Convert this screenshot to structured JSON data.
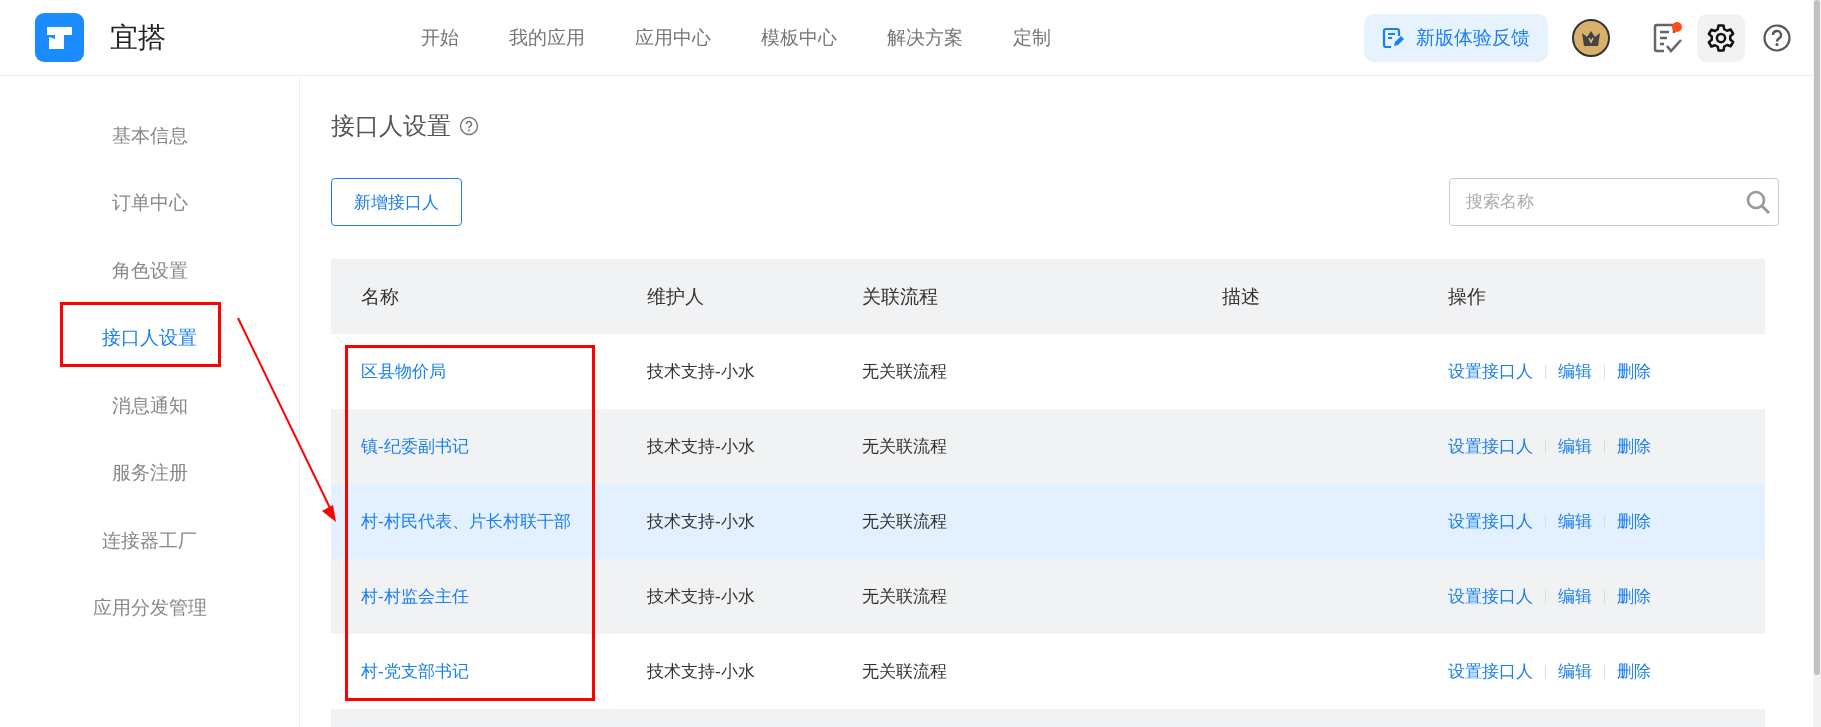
{
  "header": {
    "brand": "宜搭",
    "nav": [
      {
        "label": "开始"
      },
      {
        "label": "我的应用"
      },
      {
        "label": "应用中心"
      },
      {
        "label": "模板中心"
      },
      {
        "label": "解决方案"
      },
      {
        "label": "定制"
      }
    ],
    "feedback_button": "新版体验反馈"
  },
  "sidebar": {
    "items": [
      {
        "label": "基本信息",
        "selected": false
      },
      {
        "label": "订单中心",
        "selected": false
      },
      {
        "label": "角色设置",
        "selected": false
      },
      {
        "label": "接口人设置",
        "selected": true
      },
      {
        "label": "消息通知",
        "selected": false
      },
      {
        "label": "服务注册",
        "selected": false
      },
      {
        "label": "连接器工厂",
        "selected": false
      },
      {
        "label": "应用分发管理",
        "selected": false
      }
    ]
  },
  "page": {
    "title": "接口人设置",
    "add_button": "新增接口人",
    "search": {
      "placeholder": "搜索名称"
    }
  },
  "table": {
    "columns": [
      "名称",
      "维护人",
      "关联流程",
      "描述",
      "操作"
    ],
    "rows": [
      {
        "name": "区县物价局",
        "maintainer": "技术支持-小水",
        "process": "无关联流程",
        "actions": [
          "设置接口人",
          "编辑",
          "删除"
        ],
        "hovered": false
      },
      {
        "name": "镇-纪委副书记",
        "maintainer": "技术支持-小水",
        "process": "无关联流程",
        "actions": [
          "设置接口人",
          "编辑",
          "删除"
        ],
        "hovered": false
      },
      {
        "name": "村-村民代表、片长村联干部",
        "maintainer": "技术支持-小水",
        "process": "无关联流程",
        "actions": [
          "设置接口人",
          "编辑",
          "删除"
        ],
        "hovered": true
      },
      {
        "name": "村-村监会主任",
        "maintainer": "技术支持-小水",
        "process": "无关联流程",
        "actions": [
          "设置接口人",
          "编辑",
          "删除"
        ],
        "hovered": false
      },
      {
        "name": "村-党支部书记",
        "maintainer": "技术支持-小水",
        "process": "无关联流程",
        "actions": [
          "设置接口人",
          "编辑",
          "删除"
        ],
        "hovered": false
      }
    ]
  }
}
